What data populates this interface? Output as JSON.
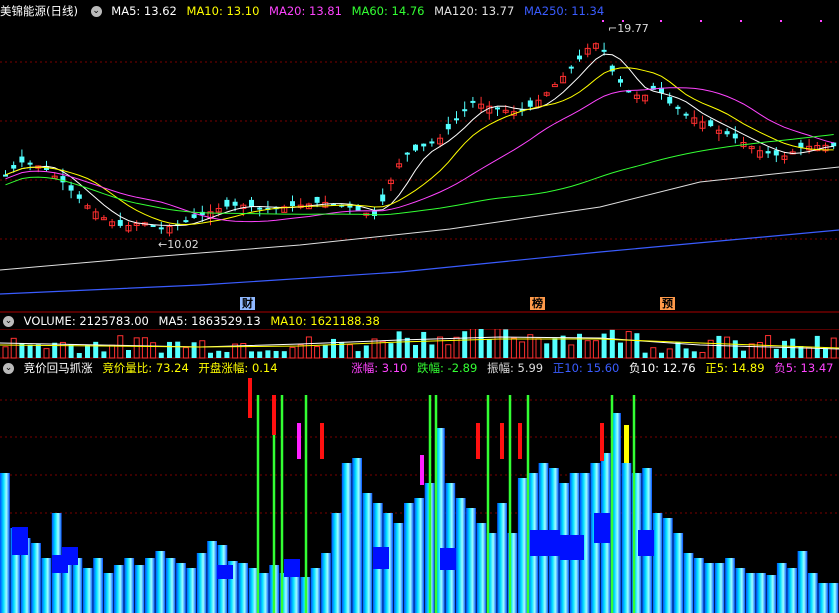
{
  "main_panel": {
    "title": "美锦能源(日线)",
    "ma": [
      {
        "label": "MA5: 13.62",
        "color": "#ffffff"
      },
      {
        "label": "MA10: 13.10",
        "color": "#ffff00"
      },
      {
        "label": "MA20: 13.81",
        "color": "#ff44ff"
      },
      {
        "label": "MA60: 14.76",
        "color": "#33ff33"
      },
      {
        "label": "MA120: 13.77",
        "color": "#e0e0e0"
      },
      {
        "label": "MA250: 11.34",
        "color": "#3a5cff"
      }
    ],
    "high_label": "19.77",
    "low_label": "10.02",
    "tags": [
      {
        "text": "财",
        "color": "#8fb8ff"
      },
      {
        "text": "榜",
        "color": "#ff9a4a"
      },
      {
        "text": "预",
        "color": "#ff9a4a"
      }
    ]
  },
  "volume_panel": {
    "items": [
      {
        "label": "VOLUME: 2125783.00",
        "color": "#ffffff"
      },
      {
        "label": "MA5: 1863529.13",
        "color": "#ffffff"
      },
      {
        "label": "MA10: 1621188.38",
        "color": "#ffff00"
      }
    ]
  },
  "indicator_panel": {
    "items": [
      {
        "label": "竞价回马抓涨",
        "color": "#ffffff"
      },
      {
        "label": "竞价量比: 73.24",
        "color": "#ffff00"
      },
      {
        "label": "开盘涨幅: 0.14",
        "color": "#ffff00"
      },
      {
        "label": "涨幅: 3.10",
        "color": "#ff44ff"
      },
      {
        "label": "跌幅: -2.89",
        "color": "#33ff33"
      },
      {
        "label": "振幅: 5.99",
        "color": "#dddddd"
      },
      {
        "label": "正10: 15.60",
        "color": "#3a5cff"
      },
      {
        "label": "负10: 12.76",
        "color": "#ffffff"
      },
      {
        "label": "正5: 14.89",
        "color": "#ffff00"
      },
      {
        "label": "负5: 13.47",
        "color": "#ff44ff"
      }
    ]
  },
  "colors": {
    "up": "#ff3030",
    "down": "#54ffff",
    "grid": "#7a0000",
    "bar_cyan": "#00d8ff",
    "bar_blue": "#0010ff"
  }
}
